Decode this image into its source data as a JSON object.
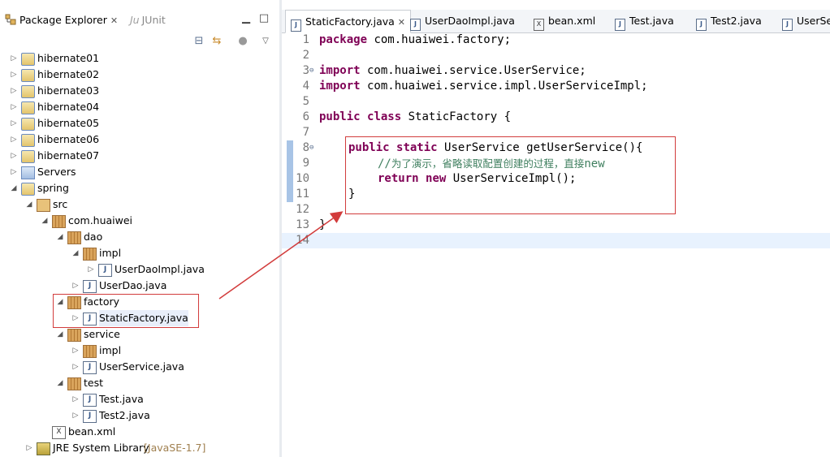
{
  "explorer": {
    "tab_label": "Package Explorer",
    "junit_label": "JUnit",
    "junit_prefix": "Ju"
  },
  "tree": [
    {
      "label": "hibernate01",
      "icon": "project-icon"
    },
    {
      "label": "hibernate02",
      "icon": "project-icon"
    },
    {
      "label": "hibernate03",
      "icon": "project-icon"
    },
    {
      "label": "hibernate04",
      "icon": "project-icon"
    },
    {
      "label": "hibernate05",
      "icon": "project-icon"
    },
    {
      "label": "hibernate06",
      "icon": "project-icon"
    },
    {
      "label": "hibernate07",
      "icon": "project-icon"
    },
    {
      "label": "Servers",
      "icon": "folder-icon"
    },
    {
      "label": "spring",
      "icon": "project-icon"
    },
    {
      "label": "src",
      "icon": "source-folder-icon"
    },
    {
      "label": "com.huaiwei",
      "icon": "package-icon"
    },
    {
      "label": "dao",
      "icon": "package-icon"
    },
    {
      "label": "impl",
      "icon": "package-icon"
    },
    {
      "label": "UserDaoImpl.java",
      "icon": "java-file-icon"
    },
    {
      "label": "UserDao.java",
      "icon": "java-interface-icon"
    },
    {
      "label": "factory",
      "icon": "package-icon"
    },
    {
      "label": "StaticFactory.java",
      "icon": "java-file-icon"
    },
    {
      "label": "service",
      "icon": "package-icon"
    },
    {
      "label": "impl",
      "icon": "package-icon"
    },
    {
      "label": "UserService.java",
      "icon": "java-interface-icon"
    },
    {
      "label": "test",
      "icon": "package-icon"
    },
    {
      "label": "Test.java",
      "icon": "java-file-icon"
    },
    {
      "label": "Test2.java",
      "icon": "java-file-icon"
    },
    {
      "label": "bean.xml",
      "icon": "xml-file-icon"
    },
    {
      "label": "JRE System Library",
      "suffix": "[JavaSE-1.7]",
      "icon": "library-icon"
    }
  ],
  "editor": {
    "tabs": [
      {
        "label": "StaticFactory.java",
        "active": true
      },
      {
        "label": "UserDaoImpl.java"
      },
      {
        "label": "bean.xml"
      },
      {
        "label": "Test.java"
      },
      {
        "label": "Test2.java"
      },
      {
        "label": "UserSe"
      }
    ],
    "line_numbers": [
      "1",
      "2",
      "3",
      "4",
      "5",
      "6",
      "7",
      "8",
      "9",
      "10",
      "11",
      "12",
      "13",
      "14"
    ],
    "line3_marker": "⊖",
    "line8_marker": "⊖",
    "code": {
      "l1_kw": "package",
      "l1_rest": " com.huaiwei.factory;",
      "l3_kw": "import",
      "l3_rest": " com.huaiwei.service.UserService;",
      "l4_kw": "import",
      "l4_rest": " com.huaiwei.service.impl.UserServiceImpl;",
      "l6_kw1": "public",
      "l6_kw2": "class",
      "l6_rest": " StaticFactory {",
      "l8_kw1": "public",
      "l8_kw2": "static",
      "l8_rest": " UserService getUserService(){",
      "l9_comment_prefix": "//",
      "l9_comment": "为了演示，省略读取配置创建的过程，直接",
      "l9_comment_suffix": "new",
      "l10_kw1": "return",
      "l10_kw2": "new",
      "l10_rest": " UserServiceImpl();",
      "l11": "}",
      "l13": "}"
    }
  },
  "colors": {
    "keyword": "#7f0055",
    "comment": "#3f7f5f",
    "highlight_box": "#d23c3c",
    "current_line": "#e8f2fe"
  }
}
